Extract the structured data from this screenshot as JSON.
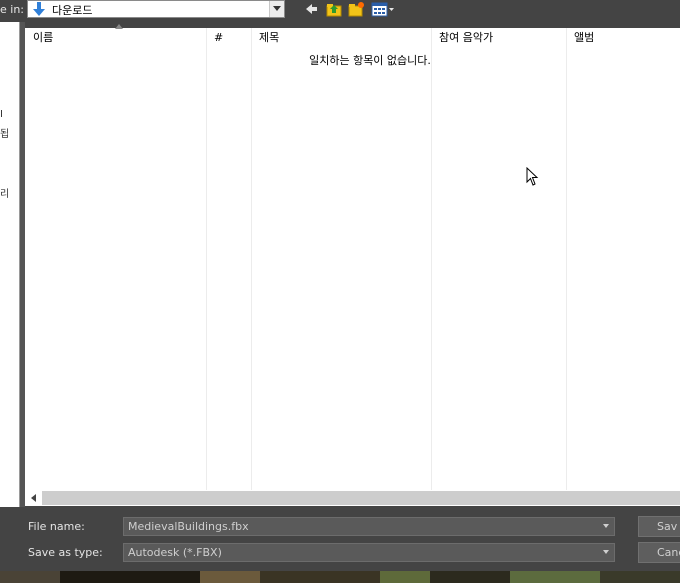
{
  "toolbar": {
    "save_in_label": "e in:",
    "location": "다운로드",
    "icons": [
      "down-arrow-icon",
      "back-icon",
      "up-folder-icon",
      "new-folder-icon",
      "view-menu-icon"
    ]
  },
  "places_bar": {
    "fragments": [
      "I",
      "됩",
      "리"
    ]
  },
  "file_list": {
    "columns": [
      "이름",
      "#",
      "제목",
      "참여 음악가",
      "앨범"
    ],
    "empty_message": "일치하는 항목이 없습니다."
  },
  "form": {
    "file_name_label": "File name:",
    "file_name_value": "MedievalBuildings.fbx",
    "save_as_type_label": "Save as type:",
    "save_as_type_value": "Autodesk (*.FBX)",
    "save_button": "Sav",
    "cancel_button": "Canc"
  },
  "colors": {
    "dialog_bg": "#444444",
    "list_bg": "#ffffff",
    "field_bg": "#5a5a5a"
  }
}
